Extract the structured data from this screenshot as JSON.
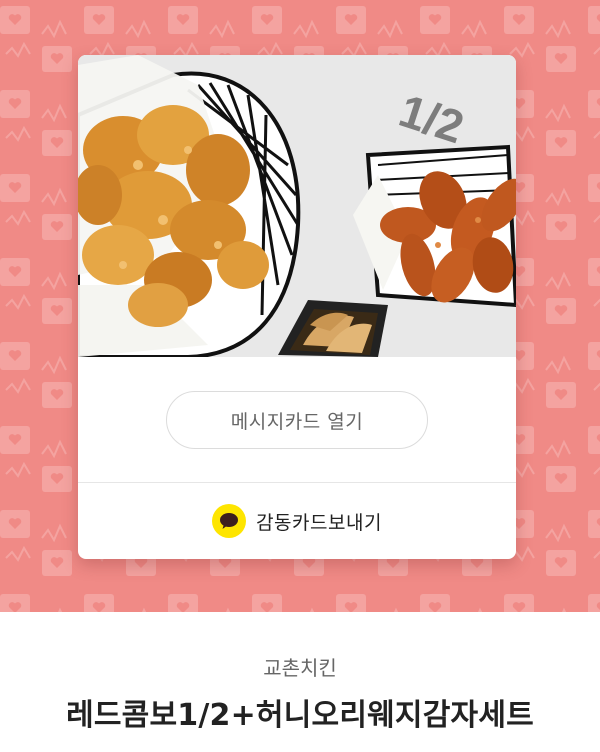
{
  "colors": {
    "background_pattern": "#f08a86",
    "pattern_icon": "#f4a3a0",
    "kakao_yellow": "#fee500",
    "kakao_bubble": "#3c1e1e"
  },
  "card": {
    "photo": {
      "overlay_text": "1/2",
      "alt_icon": "fried-chicken-photo"
    },
    "open_button_label": "메시지카드 열기",
    "send": {
      "icon": "kakaotalk-icon",
      "label": "감동카드보내기"
    }
  },
  "product": {
    "brand": "교촌치킨",
    "name": "레드콤보1/2+허니오리웨지감자세트"
  }
}
